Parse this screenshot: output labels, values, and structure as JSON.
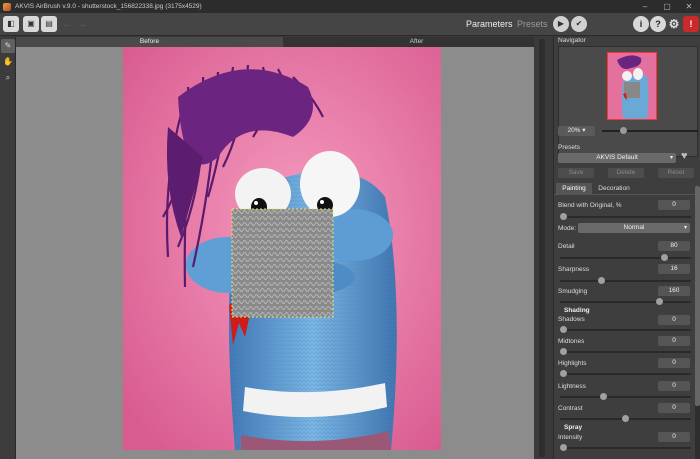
{
  "window": {
    "title": "AKVIS AirBrush v.9.0 - shutterstock_156822338.jpg (3175x4529)",
    "minimize": "–",
    "maximize": "▢",
    "close": "✕"
  },
  "toolbar": {
    "open_icon": "◧",
    "save_icon": "▣",
    "batch_icon": "▤",
    "undo_icon": "←",
    "redo_icon": "→",
    "parameters_label": "Parameters",
    "presets_label": "Presets",
    "run_icon": "▶",
    "apply_icon": "✔",
    "info_icon": "i",
    "help_icon": "?",
    "settings_icon": "⚙",
    "feedback_icon": "!"
  },
  "tools": {
    "brush_icon": "✎",
    "hand_icon": "✋",
    "zoom_icon": "⌕"
  },
  "tabs": {
    "before": "Before",
    "after": "After"
  },
  "navigator": {
    "title": "Navigator",
    "zoom": "20%"
  },
  "presets": {
    "title": "Presets",
    "selected": "AKVIS Default",
    "save": "Save",
    "delete": "Delete",
    "reset": "Reset"
  },
  "panel_tabs": {
    "painting": "Painting",
    "decoration": "Decoration"
  },
  "params": {
    "blend": {
      "label": "Blend with Original, %",
      "value": "0"
    },
    "mode": {
      "label": "Mode:",
      "value": "Normal"
    },
    "detail": {
      "label": "Detail",
      "value": "80"
    },
    "sharpness": {
      "label": "Sharpness",
      "value": "16"
    },
    "smudging": {
      "label": "Smudging",
      "value": "160"
    },
    "shading_title": "Shading",
    "shadows": {
      "label": "Shadows",
      "value": "0"
    },
    "midtones": {
      "label": "Midtones",
      "value": "0"
    },
    "highlights": {
      "label": "Highlights",
      "value": "0"
    },
    "lightness": {
      "label": "Lightness",
      "value": "0"
    },
    "contrast": {
      "label": "Contrast",
      "value": "0"
    },
    "spray_title": "Spray",
    "intensity": {
      "label": "Intensity",
      "value": "0"
    }
  },
  "colors": {
    "background": "#e4709d",
    "sock_blue": "#6aa8d6",
    "hair": "#6a1f7a",
    "tongue": "#d11a1a"
  }
}
